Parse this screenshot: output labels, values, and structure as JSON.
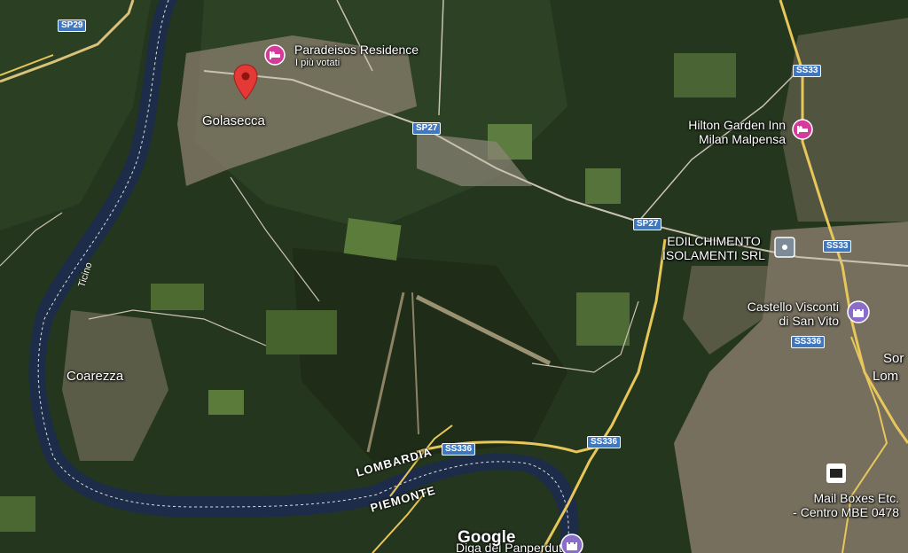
{
  "places": {
    "golasecca": "Golasecca",
    "coarezza": "Coarezza",
    "somma_partial_1": "Sor",
    "somma_partial_2": "Lom"
  },
  "pois": {
    "paradeisos_name": "Paradeisos Residence",
    "paradeisos_sub": "I più votati",
    "hilton_line1": "Hilton Garden Inn",
    "hilton_line2": "Milan Malpensa",
    "edil_line1": "EDILCHIMENTO",
    "edil_line2": "ISOLAMENTI SRL",
    "castello_line1": "Castello Visconti",
    "castello_line2": "di San Vito",
    "mail_line1": "Mail Boxes Etc.",
    "mail_line2": "- Centro MBE 0478",
    "diga": "Diga del Panperduto"
  },
  "roads": {
    "sp29": "SP29",
    "sp27_a": "SP27",
    "sp27_b": "SP27",
    "ss33_a": "SS33",
    "ss33_b": "SS33",
    "ss336_a": "SS336",
    "ss336_b": "SS336",
    "ss336_c": "SS336"
  },
  "water": {
    "ticino": "Ticino"
  },
  "regions": {
    "lombardia": "LOMBARDIA",
    "piemonte": "PIEMONTE"
  },
  "attribution": {
    "logo": "Google"
  },
  "colors": {
    "forest": "#23331d",
    "river": "#1d2c48",
    "road_major": "#e7c65a",
    "shield": "#3f78c0",
    "hotel_pin": "#d63a9b",
    "location_pin": "#e53935"
  },
  "icons": {
    "hotel": "bed-icon",
    "landmark": "castle-icon",
    "business": "square-icon",
    "location": "map-pin-icon"
  }
}
